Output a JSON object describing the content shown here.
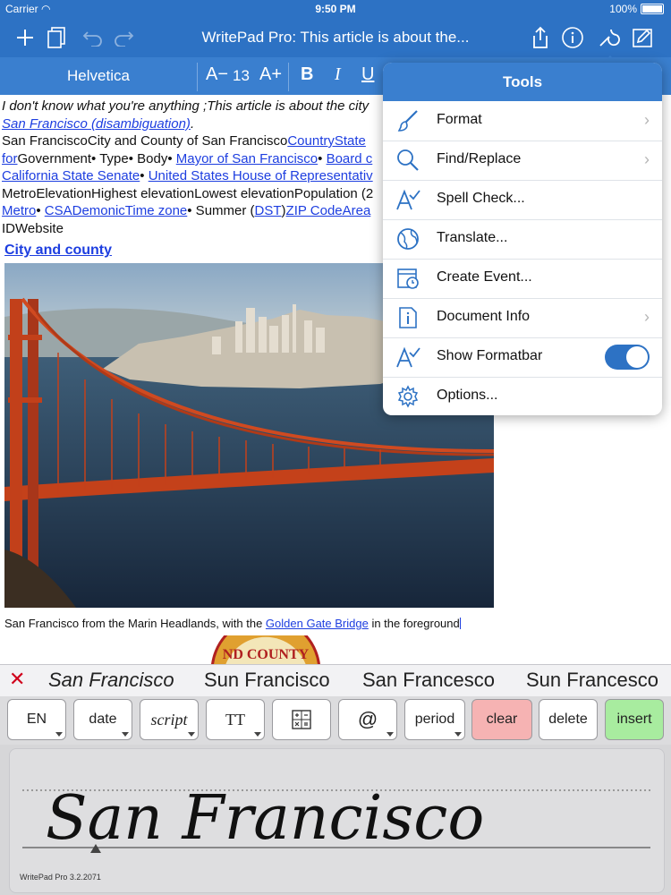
{
  "status": {
    "carrier": "Carrier",
    "time": "9:50 PM",
    "battery": "100%"
  },
  "nav": {
    "title": "WritePad Pro: This article is about the..."
  },
  "formatbar": {
    "font": "Helvetica",
    "size": "13"
  },
  "document": {
    "line1_italic": "I don't know what you're anything ;This article is about the city",
    "line2_link": "San Francisco (disambiguation)",
    "line3_text": "San FranciscoCity and County of San Francisco",
    "line3_link": "CountryState",
    "line4_link1": "for",
    "line4_text1": "Government• Type• Body• ",
    "line4_link2": "Mayor of San Francisco",
    "line4_text2": "• ",
    "line4_link3": "Board c",
    "line5_link1": "California State Senate",
    "line5_text1": "• ",
    "line5_link2": "United States House of Representativ",
    "line6_text": "MetroElevationHighest elevationLowest elevationPopulation (2",
    "line7_link1": "Metro",
    "line7_text1": "• ",
    "line7_link2": "CSADemonicTime zone",
    "line7_text2": "• Summer (",
    "line7_link3": "DST",
    "line7_text3": ")",
    "line7_link4": "ZIP CodeArea",
    "line8_text": "IDWebsite",
    "heading": "City and county",
    "caption_text": "San Francisco from the Marin Headlands, with the ",
    "caption_link": "Golden Gate Bridge",
    "caption_text2": " in the foreground",
    "seal_text": "ND COUNTY"
  },
  "tools": {
    "title": "Tools",
    "items": [
      {
        "label": "Format",
        "icon": "brush-icon",
        "chevron": true
      },
      {
        "label": "Find/Replace",
        "icon": "search-icon",
        "chevron": true
      },
      {
        "label": "Spell Check...",
        "icon": "spellcheck-icon",
        "chevron": false
      },
      {
        "label": "Translate...",
        "icon": "globe-icon",
        "chevron": false
      },
      {
        "label": "Create Event...",
        "icon": "calendar-icon",
        "chevron": false
      },
      {
        "label": "Document Info",
        "icon": "info-icon",
        "chevron": true
      },
      {
        "label": "Show Formatbar",
        "icon": "formatbar-icon",
        "toggle": true,
        "toggle_on": true
      },
      {
        "label": "Options...",
        "icon": "gear-icon",
        "chevron": false
      }
    ]
  },
  "suggestions": [
    "San Francisco",
    "Sun Francisco",
    "San Francesco",
    "Sun Francesco"
  ],
  "keys": {
    "en": "EN",
    "date": "date",
    "script": "script",
    "tt": "TT",
    "at": "@",
    "period": "period",
    "clear": "clear",
    "delete": "delete",
    "insert": "insert"
  },
  "writepad": {
    "handwriting": "San Francisco",
    "version": "WritePad Pro 3.2.2071"
  },
  "colors": {
    "accent": "#2d72c4",
    "clear_key": "#f6b3b3",
    "insert_key": "#a8ec9f"
  }
}
